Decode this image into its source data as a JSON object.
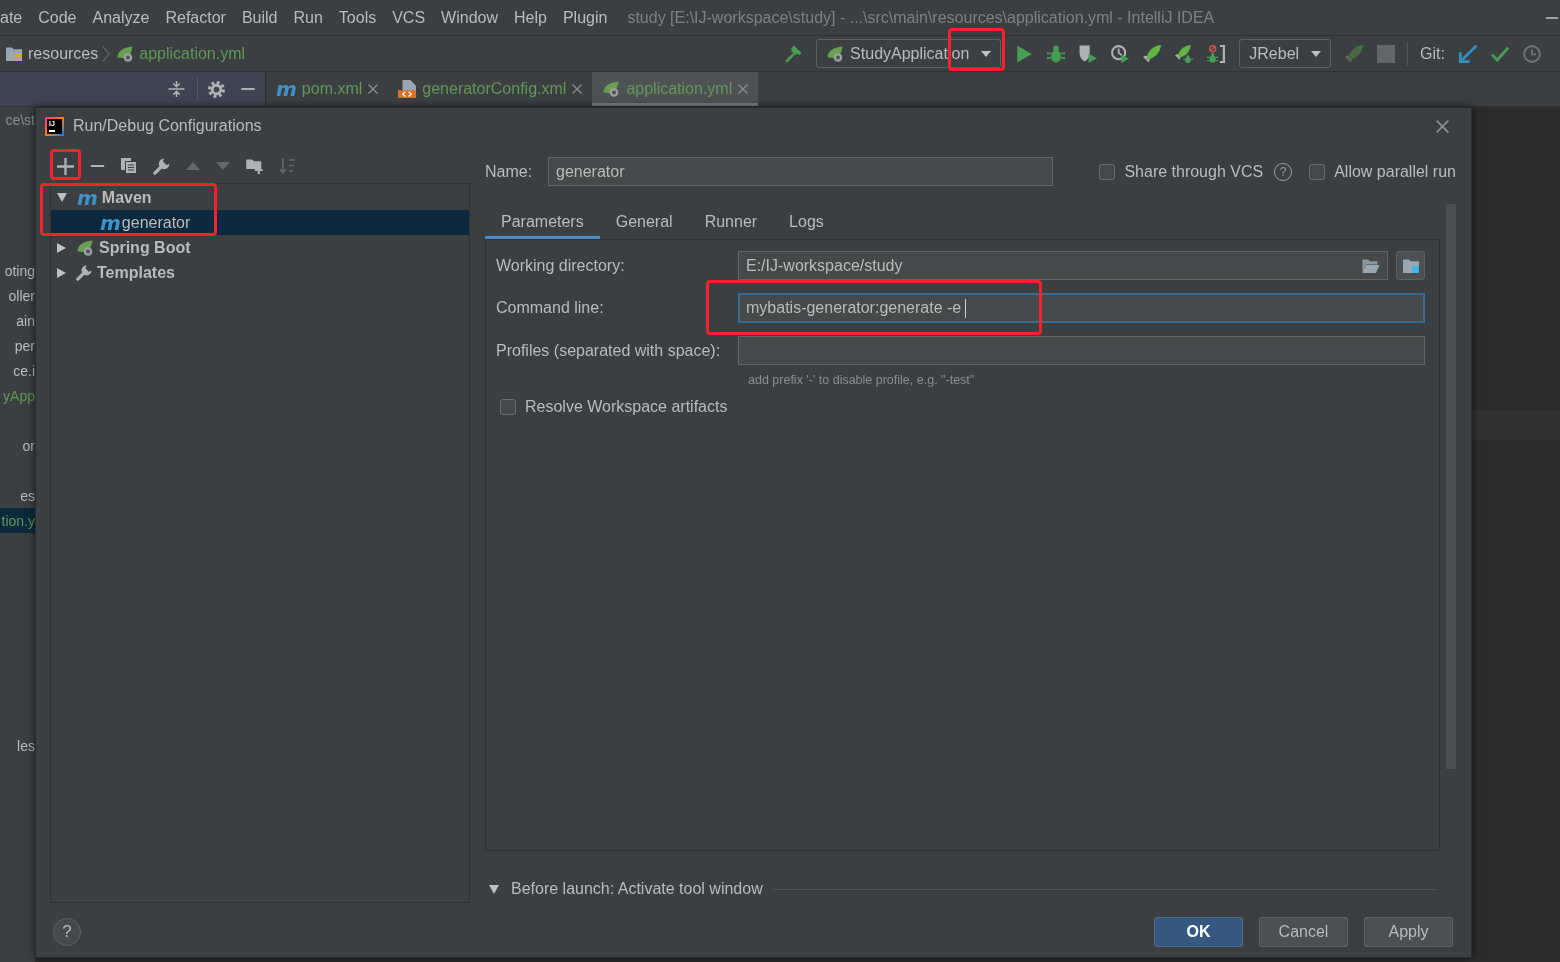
{
  "menu_bar": {
    "items": [
      {
        "label": "ate"
      },
      {
        "label": "Code"
      },
      {
        "label": "Analyze"
      },
      {
        "label": "Refactor"
      },
      {
        "label": "Build"
      },
      {
        "label": "Run"
      },
      {
        "label": "Tools"
      },
      {
        "label": "VCS"
      },
      {
        "label": "Window"
      },
      {
        "label": "Help"
      },
      {
        "label": "Plugin"
      }
    ],
    "window_title": "study [E:\\IJ-workspace\\study] - ...\\src\\main\\resources\\application.yml - IntelliJ IDEA"
  },
  "nav_bar": {
    "breadcrumbs": [
      {
        "label": "resources",
        "kind": "folder",
        "color": "#bbbbbb"
      },
      {
        "label": "application.yml",
        "kind": "yaml",
        "color": "#629755"
      }
    ],
    "toolbar": [
      {
        "kind": "build",
        "disabled": false
      },
      {
        "kind": "run_config",
        "label": "StudyApplication",
        "highlighted": true
      },
      {
        "kind": "run",
        "disabled": false
      },
      {
        "kind": "debug",
        "disabled": false
      },
      {
        "kind": "coverage",
        "disabled": false
      },
      {
        "kind": "profile",
        "disabled": false
      },
      {
        "kind": "jrebel_run",
        "disabled": false
      },
      {
        "kind": "jrebel_debug",
        "disabled": false
      },
      {
        "kind": "attach",
        "disabled": false
      },
      {
        "kind": "dropdown",
        "label": "JRebel",
        "highlighted": false
      },
      {
        "kind": "jrebel_update",
        "disabled": true
      },
      {
        "kind": "stop",
        "disabled": true
      },
      {
        "kind": "separator"
      },
      {
        "kind": "label",
        "label": "Git:"
      },
      {
        "kind": "vcs_update",
        "disabled": false
      },
      {
        "kind": "vcs_commit",
        "disabled": false
      },
      {
        "kind": "vcs_history",
        "disabled": false
      }
    ]
  },
  "editor_tabs": [
    {
      "label": "pom.xml",
      "kind": "maven",
      "icon_text": "m",
      "color": "#629755",
      "selected": false
    },
    {
      "label": "generatorConfig.xml",
      "kind": "xml",
      "color": "#629755",
      "selected": false
    },
    {
      "label": "application.yml",
      "kind": "yaml",
      "color": "#629755",
      "selected": true
    }
  ],
  "project_tree": {
    "header": "ce\\st",
    "items": [
      {
        "text": "oting",
        "color": "#bbbbbb",
        "selected": false
      },
      {
        "text": "oller",
        "color": "#bbbbbb",
        "selected": false
      },
      {
        "text": "ain",
        "color": "#bbbbbb",
        "selected": false
      },
      {
        "text": "per",
        "color": "#bbbbbb",
        "selected": false
      },
      {
        "text": "ce.i",
        "color": "#bbbbbb",
        "selected": false
      },
      {
        "text": "yApp",
        "color": "#629755",
        "selected": false
      },
      {
        "text": "or",
        "color": "#bbbbbb",
        "selected": false
      },
      {
        "text": "es",
        "color": "#bbbbbb",
        "selected": false
      },
      {
        "text": "tion.y",
        "color": "#629755",
        "selected": true
      },
      {
        "text": "les",
        "color": "#bbbbbb",
        "selected": false
      }
    ]
  },
  "dialog": {
    "title": "Run/Debug Configurations",
    "icon_text": "IJ",
    "toolbar": [
      {
        "kind": "add",
        "disabled": false,
        "highlighted": true
      },
      {
        "kind": "remove",
        "disabled": false,
        "highlighted": false
      },
      {
        "kind": "copy",
        "disabled": false,
        "highlighted": false
      },
      {
        "kind": "edit_defaults",
        "disabled": false,
        "highlighted": false
      },
      {
        "kind": "move_up",
        "disabled": true,
        "highlighted": false
      },
      {
        "kind": "move_down",
        "disabled": true,
        "highlighted": false
      },
      {
        "kind": "new_folder",
        "disabled": false,
        "highlighted": false
      },
      {
        "kind": "sort",
        "disabled": true,
        "highlighted": false
      }
    ],
    "tree": [
      {
        "label": "Maven",
        "kind": "maven",
        "icon_text": "m",
        "expanded": true,
        "selected": false,
        "highlighted": true,
        "children": [
          {
            "label": "generator",
            "kind": "maven",
            "icon_text": "m",
            "selected": true
          }
        ]
      },
      {
        "label": "Spring Boot",
        "kind": "spring",
        "expanded": false,
        "selected": false,
        "highlighted": false
      },
      {
        "label": "Templates",
        "kind": "templates",
        "expanded": false,
        "selected": false,
        "highlighted": false
      }
    ],
    "name_field": {
      "label": "Name:",
      "value": "generator"
    },
    "options": [
      {
        "label": "Share through VCS",
        "checked": false,
        "help": "?"
      },
      {
        "label": "Allow parallel run",
        "checked": false
      }
    ],
    "tabs": [
      {
        "label": "Parameters",
        "selected": true
      },
      {
        "label": "General",
        "selected": false
      },
      {
        "label": "Runner",
        "selected": false
      },
      {
        "label": "Logs",
        "selected": false
      }
    ],
    "fields": [
      {
        "label": "Working directory:",
        "kind": "path",
        "value": "E:/IJ-workspace/study",
        "focused": false,
        "highlighted": false
      },
      {
        "label": "Command line:",
        "kind": "text",
        "value": "mybatis-generator:generate -e",
        "focused": true,
        "highlighted": true
      },
      {
        "label": "Profiles (separated with space):",
        "kind": "text",
        "focused": false,
        "highlighted": false,
        "hint": "add prefix '-' to disable profile, e.g. \"-test\""
      }
    ],
    "resolve_workspace": {
      "label": "Resolve Workspace artifacts",
      "checked": false
    },
    "before_launch": {
      "label": "Before launch: Activate tool window",
      "expanded": true
    },
    "help_button": "?",
    "buttons": [
      {
        "label": "OK",
        "kind": "default"
      },
      {
        "label": "Cancel",
        "kind": "normal"
      },
      {
        "label": "Apply",
        "kind": "normal"
      }
    ]
  }
}
